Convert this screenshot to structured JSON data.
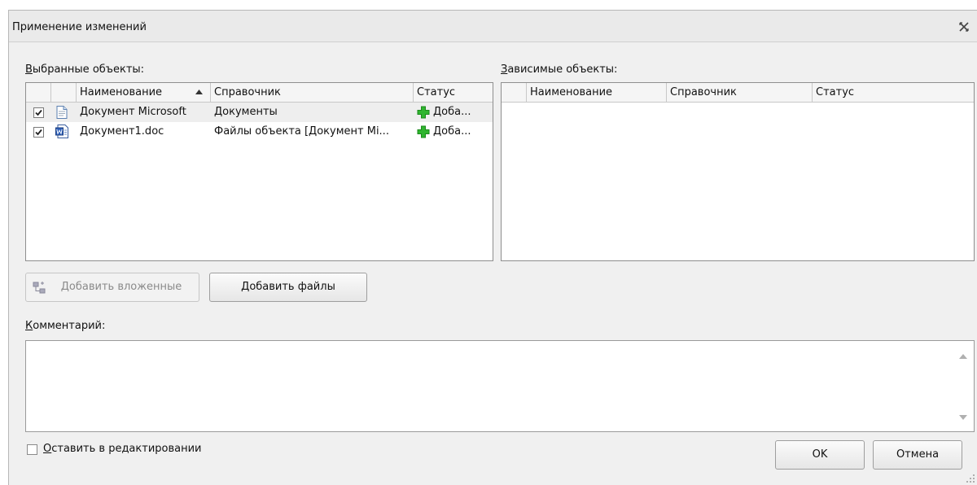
{
  "window": {
    "title": "Применение изменений"
  },
  "left_panel": {
    "label_prefix": "В",
    "label_rest": "ыбранные объекты:",
    "columns": [
      "Наименование",
      "Справочник",
      "Статус"
    ],
    "rows": [
      {
        "checked": true,
        "icon": "document-icon",
        "name": "Документ Microsoft",
        "directory": "Документы",
        "status": "Доба..."
      },
      {
        "checked": true,
        "icon": "word-doc-icon",
        "name": "Документ1.doc",
        "directory": "Файлы объекта [Документ Mi...",
        "status": "Доба..."
      }
    ]
  },
  "right_panel": {
    "label_prefix": "З",
    "label_rest": "ависимые объекты:",
    "columns": [
      "Наименование",
      "Справочник",
      "Статус"
    ]
  },
  "buttons": {
    "add_nested": "Добавить вложенные",
    "add_files": "Добавить файлы",
    "ok": "OK",
    "cancel": "Отмена"
  },
  "comment": {
    "label_prefix": "К",
    "label_rest": "омментарий:",
    "value": ""
  },
  "keep_editing": {
    "checked": false,
    "label_prefix": "О",
    "label_rest": "ставить в редактировании"
  },
  "colors": {
    "add_status": "#2fb52f",
    "sort_arrow": "#333333"
  }
}
